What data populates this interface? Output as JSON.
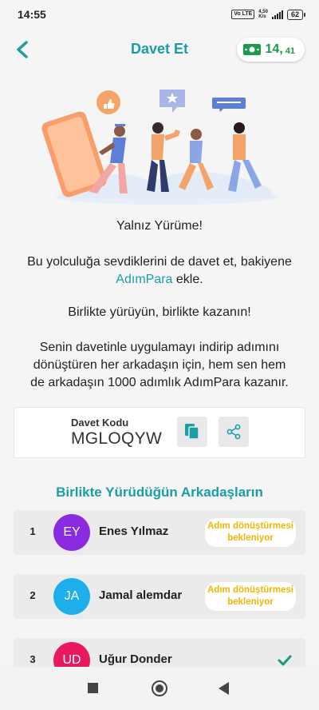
{
  "status_bar": {
    "time": "14:55",
    "volte": "Vo LTE",
    "network_speed": "4,50",
    "network_unit": "K/s",
    "battery": "62"
  },
  "header": {
    "title": "Davet Et",
    "balance_int": "14,",
    "balance_dec": "41"
  },
  "content": {
    "tagline": "Yalnız Yürüme!",
    "invite_prefix": "Bu yolculuğa sevdiklerini de davet et, bakiyene",
    "invite_brand": "AdımPara",
    "invite_suffix": " ekle.",
    "together": "Birlikte yürüyün, birlikte kazanın!",
    "reward_line1": "Senin davetinle uygulamayı indirip adımını",
    "reward_line2": "dönüştüren her arkadaşın için, hem sen hem",
    "reward_line3": "de arkadaşın 1000 adımlık AdımPara kazanır."
  },
  "invite_code": {
    "label": "Davet Kodu",
    "value": "MGLOQYW"
  },
  "friends": {
    "title": "Birlikte Yürüdüğün Arkadaşların",
    "items": [
      {
        "rank": "1",
        "initials": "EY",
        "name": "Enes Yılmaz",
        "status": "Adım dönüştürmesi bekleniyor",
        "avatar_color": "#8a2be2"
      },
      {
        "rank": "2",
        "initials": "JA",
        "name": "Jamal alemdar",
        "status": "Adım dönüştürmesi bekleniyor",
        "avatar_color": "#1eaeea"
      },
      {
        "rank": "3",
        "initials": "UD",
        "name": "Uğur Donder",
        "status": "",
        "avatar_color": "#e8195e"
      }
    ]
  },
  "colors": {
    "accent": "#1a9ea6",
    "money": "#1a9a4a",
    "pending": "#f2b500",
    "check": "#1a9a7a"
  }
}
